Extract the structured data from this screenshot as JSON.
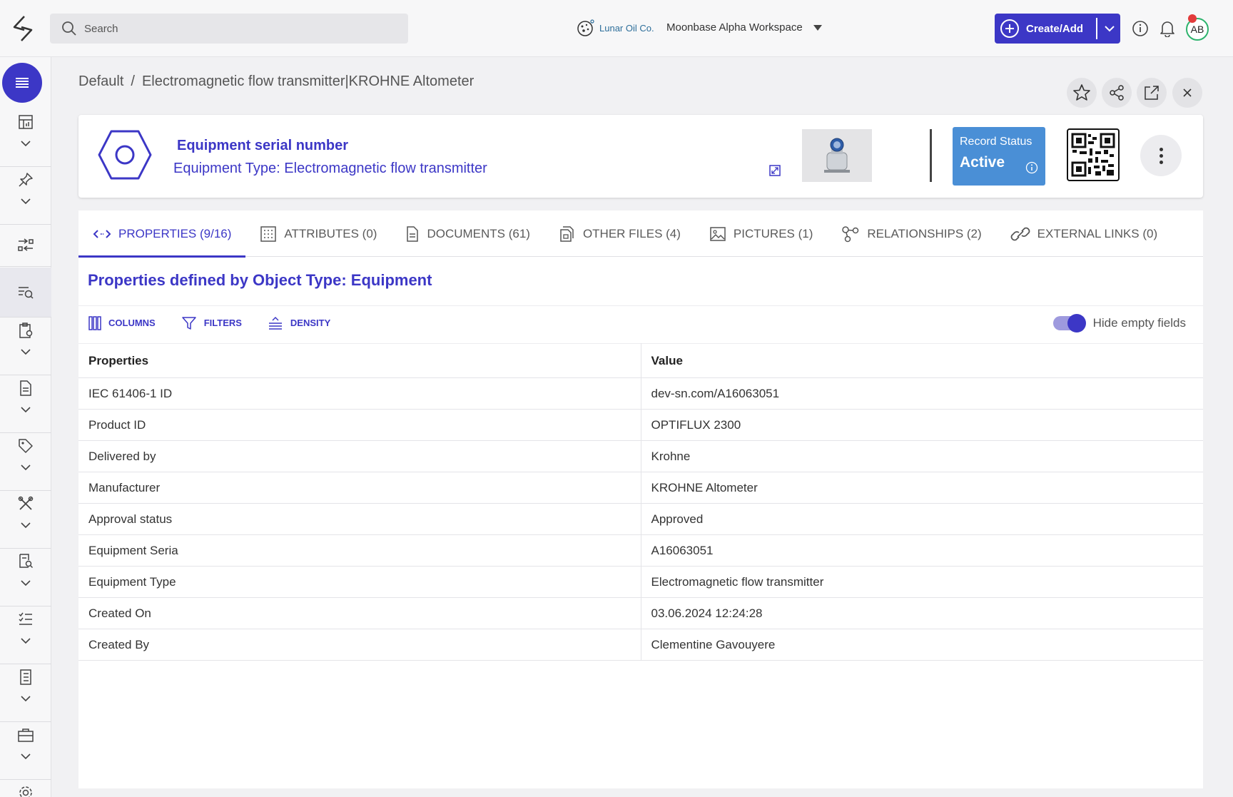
{
  "topbar": {
    "search_placeholder": "Search",
    "company_name": "Lunar Oil Co.",
    "workspace": "Moonbase Alpha Workspace",
    "create_label": "Create/Add",
    "avatar_initials": "AB"
  },
  "sidebar": {
    "items": [
      {
        "icon": "dashboard-icon"
      },
      {
        "icon": "pin-icon"
      },
      {
        "icon": "workflow-icon"
      },
      {
        "icon": "search-list-icon"
      },
      {
        "icon": "clipboard-settings-icon"
      },
      {
        "icon": "document-icon"
      },
      {
        "icon": "tag-icon"
      },
      {
        "icon": "tools-icon"
      },
      {
        "icon": "report-search-icon"
      },
      {
        "icon": "checklist-icon"
      },
      {
        "icon": "notebook-icon"
      },
      {
        "icon": "toolbox-icon"
      },
      {
        "icon": "gear-icon"
      }
    ]
  },
  "breadcrumb": {
    "root": "Default",
    "separator": "/",
    "current": "Electromagnetic flow transmitter|KROHNE Altometer"
  },
  "record": {
    "title": "Equipment serial number",
    "type_line": "Equipment Type: Electromagnetic flow transmitter",
    "status_label": "Record Status",
    "status_value": "Active"
  },
  "tabs": [
    {
      "label": "PROPERTIES (9/16)",
      "icon": "code-icon",
      "active": true
    },
    {
      "label": "ATTRIBUTES (0)",
      "icon": "grid-icon",
      "active": false
    },
    {
      "label": "DOCUMENTS (61)",
      "icon": "document-icon",
      "active": false
    },
    {
      "label": "OTHER FILES (4)",
      "icon": "files-icon",
      "active": false
    },
    {
      "label": "PICTURES (1)",
      "icon": "image-icon",
      "active": false
    },
    {
      "label": "RELATIONSHIPS (2)",
      "icon": "relationships-icon",
      "active": false
    },
    {
      "label": "EXTERNAL LINKS (0)",
      "icon": "link-icon",
      "active": false
    }
  ],
  "properties": {
    "section_title": "Properties defined by Object Type: Equipment",
    "toolbar": {
      "columns": "COLUMNS",
      "filters": "FILTERS",
      "density": "DENSITY",
      "hide_empty": "Hide empty fields"
    },
    "headers": [
      "Properties",
      "Value"
    ],
    "rows": [
      [
        "IEC 61406-1 ID",
        "dev-sn.com/A16063051"
      ],
      [
        "Product ID",
        "OPTIFLUX 2300"
      ],
      [
        "Delivered by",
        "Krohne"
      ],
      [
        "Manufacturer",
        "KROHNE Altometer"
      ],
      [
        "Approval status",
        "Approved"
      ],
      [
        "Equipment Seria",
        "A16063051"
      ],
      [
        "Equipment Type",
        "Electromagnetic flow transmitter"
      ],
      [
        "Created On",
        "03.06.2024 12:24:28"
      ],
      [
        "Created By",
        "Clementine Gavouyere"
      ]
    ]
  },
  "colors": {
    "accent": "#3c37c6",
    "status_blue": "#4a8fd6",
    "avatar_ring": "#2db36d",
    "notify_red": "#e23b3b"
  }
}
